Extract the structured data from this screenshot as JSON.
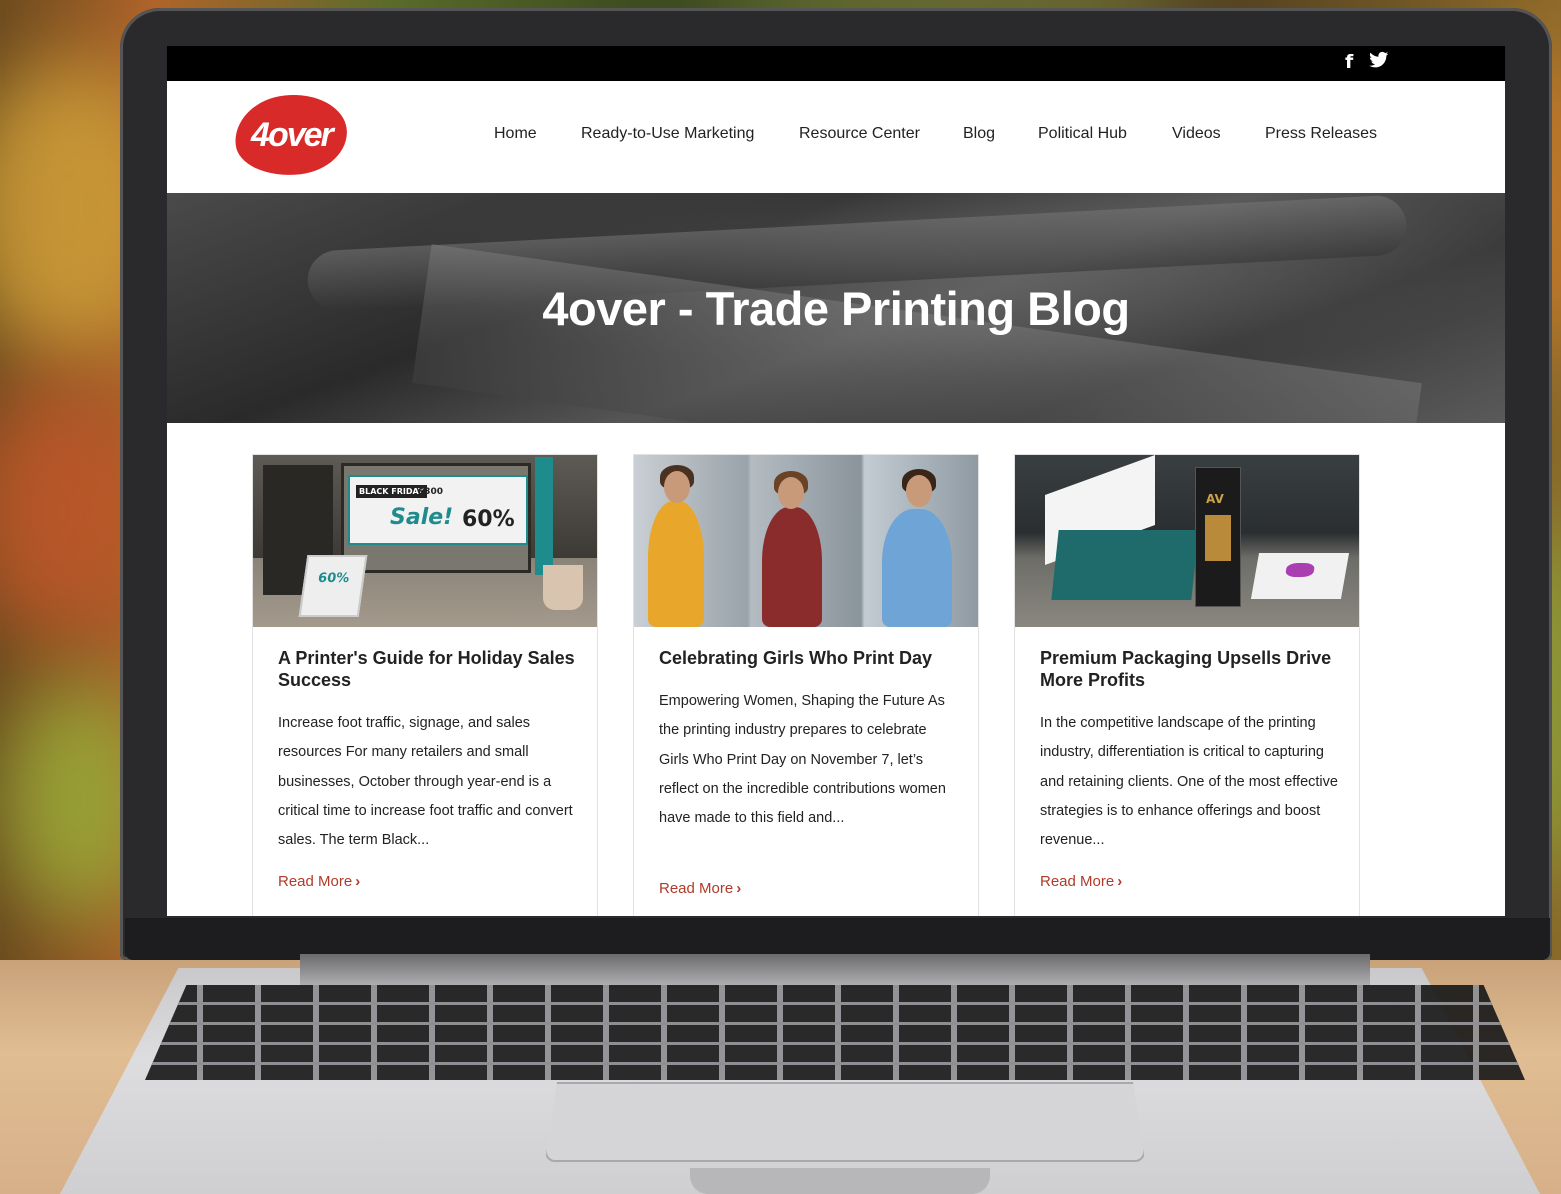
{
  "social": {
    "facebook_icon": "f",
    "twitter_icon": "🐦"
  },
  "brand": {
    "logo_text": "4over",
    "logo_color": "#d92a2a"
  },
  "nav": {
    "items": [
      {
        "label": "Home"
      },
      {
        "label": "Ready-to-Use Marketing"
      },
      {
        "label": "Resource Center"
      },
      {
        "label": "Blog"
      },
      {
        "label": "Political Hub"
      },
      {
        "label": "Videos"
      },
      {
        "label": "Press Releases"
      }
    ]
  },
  "hero": {
    "title": "4over - Trade Printing Blog"
  },
  "posts": [
    {
      "title": "A Printer's Guide for Holiday Sales Success",
      "excerpt": "Increase foot traffic, signage, and sales resources For many retailers and small businesses, October through year-end is a critical time to increase foot traffic and convert sales. The term Black...",
      "read_more": "Read More",
      "image_text": {
        "black_friday": "BLACK FRIDAY",
        "price": "$300",
        "sale": "Sale!",
        "percent": "60%",
        "vertical": "BLACK FRIDAY Sale!",
        "aframe_percent": "60%"
      }
    },
    {
      "title": "Celebrating Girls Who Print Day",
      "excerpt": "Empowering Women, Shaping the Future As the printing industry prepares to celebrate Girls Who Print Day on November 7, let’s reflect on the incredible contributions women have made to this field and...",
      "read_more": "Read More"
    },
    {
      "title": "Premium Packaging Upsells Drive More Profits",
      "excerpt": "In the competitive landscape of the printing industry, differentiation is critical to capturing and retaining clients. One of the most effective strategies is to enhance offerings and boost revenue...",
      "read_more": "Read More",
      "image_text": {
        "bottle_label": "AV"
      }
    }
  ],
  "colors": {
    "accent": "#b23a2a",
    "social_bar": "#000000",
    "text": "#222222"
  }
}
